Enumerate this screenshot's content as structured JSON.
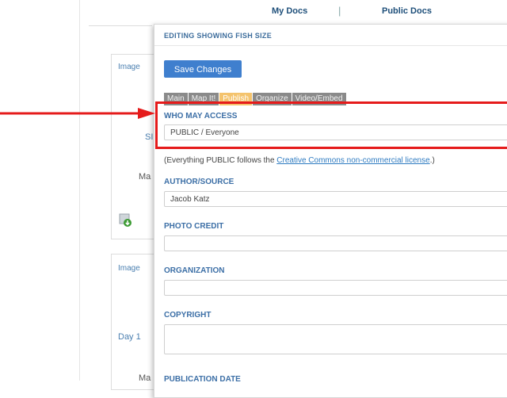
{
  "topnav": {
    "my_docs": "My Docs",
    "separator": "|",
    "public_docs": "Public Docs"
  },
  "background_cards": [
    {
      "label": "Image",
      "fragments": [
        "SI",
        "Ma"
      ]
    },
    {
      "label": "Image",
      "fragments": [
        "Day 1",
        "Ma"
      ]
    }
  ],
  "modal": {
    "title": "EDITING SHOWING FISH SIZE",
    "save_label": "Save Changes",
    "tabs": [
      {
        "label": "Main",
        "active": false
      },
      {
        "label": "Map It!",
        "active": false
      },
      {
        "label": "Publish",
        "active": true
      },
      {
        "label": "Organize",
        "active": false
      },
      {
        "label": "Video/Embed",
        "active": false
      }
    ],
    "fields": {
      "access": {
        "label": "WHO MAY ACCESS",
        "value": "PUBLIC / Everyone"
      },
      "note_prefix": "(Everything PUBLIC follows the ",
      "note_link": "Creative Commons non-commercial license",
      "note_suffix": ".)",
      "author": {
        "label": "AUTHOR/SOURCE",
        "value": "Jacob Katz"
      },
      "photo_credit": {
        "label": "PHOTO CREDIT",
        "value": ""
      },
      "organization": {
        "label": "ORGANIZATION",
        "value": ""
      },
      "copyright": {
        "label": "COPYRIGHT",
        "value": ""
      },
      "publication_date": {
        "label": "PUBLICATION DATE"
      }
    }
  },
  "colors": {
    "accent": "#3f7fce",
    "active_tab": "#f4c36d",
    "highlight": "#e51b1b"
  },
  "icons": {
    "download": "download-icon",
    "arrow": "red-arrow-icon"
  }
}
